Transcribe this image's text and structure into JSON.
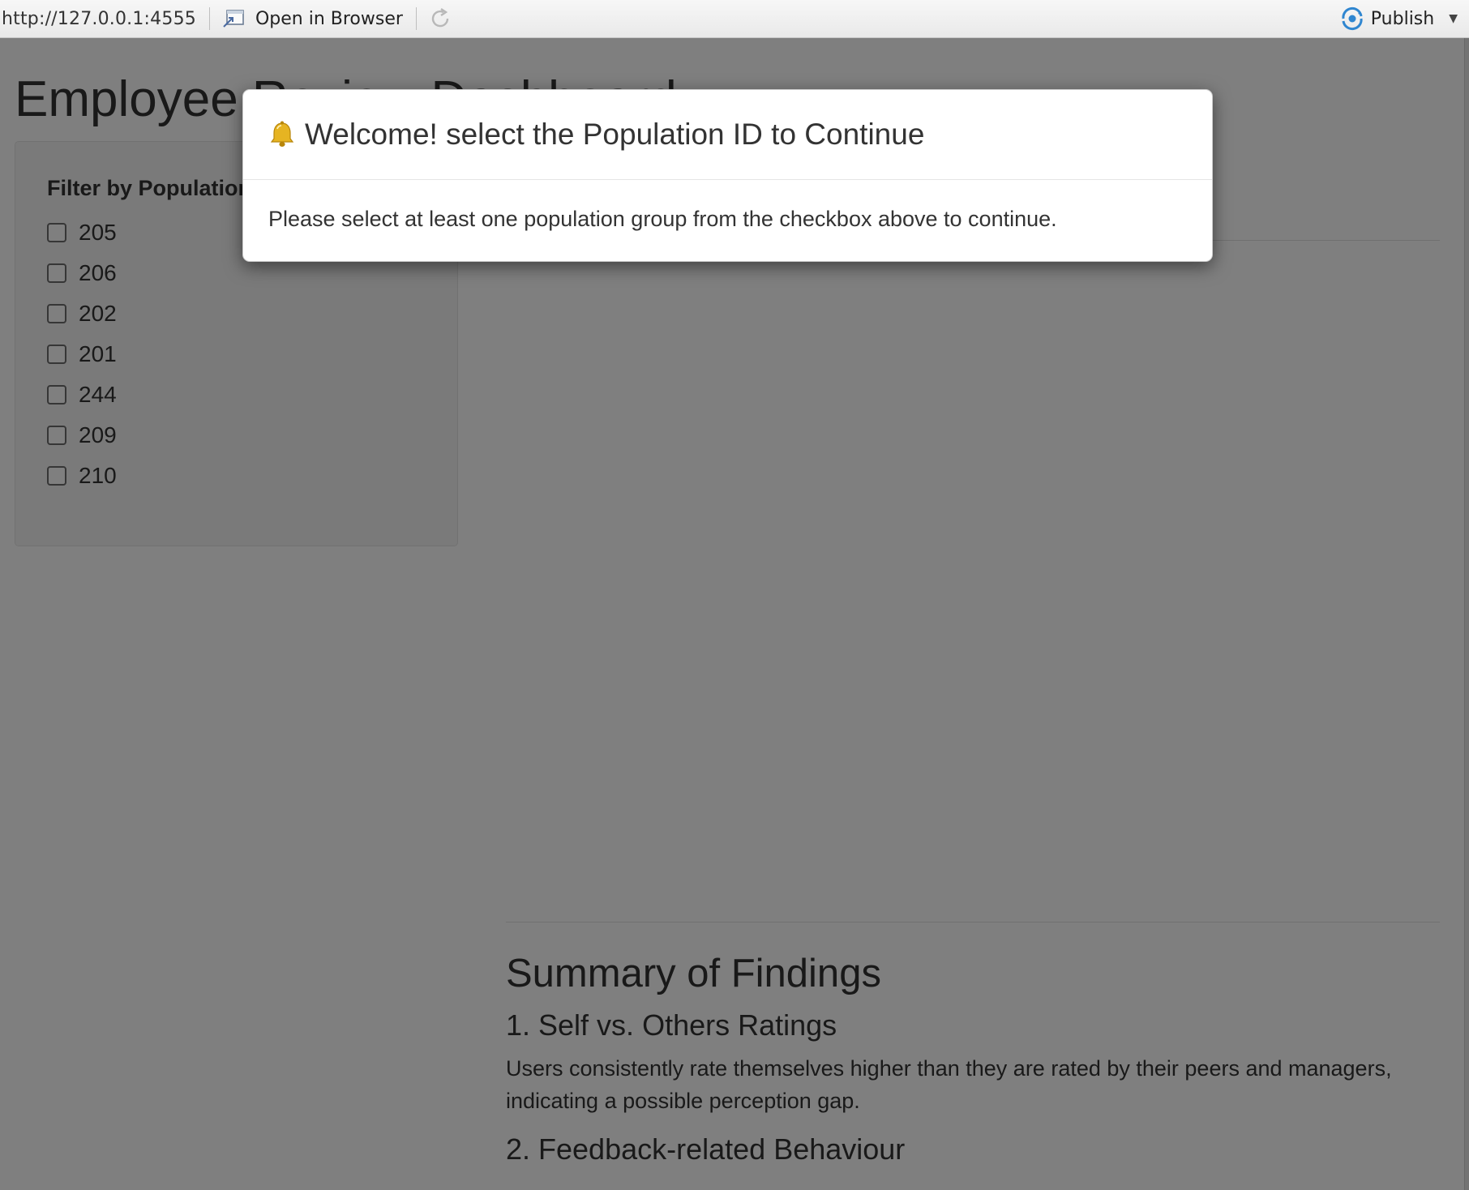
{
  "toolbar": {
    "url": "http://127.0.0.1:4555",
    "open_in_browser_label": "Open in Browser",
    "publish_label": "Publish"
  },
  "page": {
    "title": "Employee Review Dashboard",
    "sidebar": {
      "filter_label": "Filter by Population ID:",
      "options": [
        "205",
        "206",
        "202",
        "201",
        "244",
        "209",
        "210"
      ],
      "checked": [
        false,
        false,
        false,
        false,
        false,
        false,
        false
      ]
    },
    "summary": {
      "heading": "Summary of Findings",
      "section1_title": "1. Self vs. Others Ratings",
      "section1_text": "Users consistently rate themselves higher than they are rated by their peers and managers, indicating a possible perception gap.",
      "section2_title": "2. Feedback-related Behaviour"
    }
  },
  "modal": {
    "icon": "bell-icon",
    "title": "Welcome! select the Population ID to Continue",
    "body": "Please select at least one population group from the checkbox above to continue."
  },
  "colors": {
    "backdrop": "rgba(0,0,0,0.5)",
    "publish_accent": "#2f86d0",
    "bell": "#e6b422"
  }
}
